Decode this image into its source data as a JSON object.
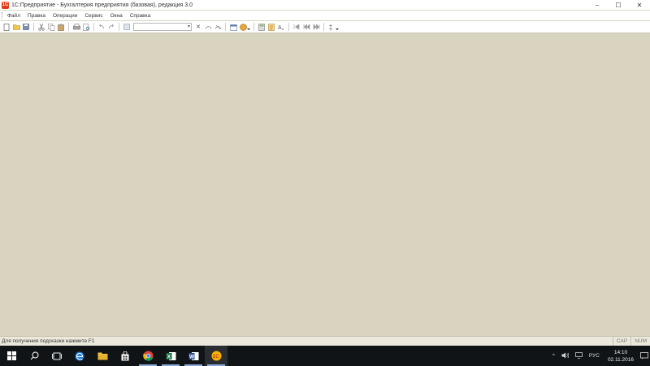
{
  "window": {
    "title": "1С:Предприятие - Бухгалтерия предприятия (базовая), редакция 3.0",
    "icon": "1c-logo-icon",
    "controls": {
      "minimize": "–",
      "maximize": "☐",
      "close": "✕"
    }
  },
  "menu": {
    "items": [
      {
        "label": "Файл"
      },
      {
        "label": "Правка"
      },
      {
        "label": "Операции"
      },
      {
        "label": "Сервис"
      },
      {
        "label": "Окна"
      },
      {
        "label": "Справка"
      }
    ]
  },
  "toolbar": {
    "search_value": "",
    "icons": [
      "new-document-icon",
      "open-folder-icon",
      "save-icon",
      "cut-icon",
      "copy-icon",
      "paste-icon",
      "print-icon",
      "print-preview-icon",
      "undo-icon",
      "redo-icon",
      "find-icon",
      "clear-icon",
      "find-next-icon",
      "find-prev-icon",
      "calendar-icon",
      "calculator-icon",
      "help-icon",
      "first-record-icon",
      "prev-record-icon",
      "next-record-icon",
      "font-size-icon"
    ]
  },
  "statusbar": {
    "hint": "Для получения подсказки нажмите F1",
    "cap": "CAP",
    "num": "NUM"
  },
  "taskbar": {
    "apps": [
      "windows-start-icon",
      "search-icon",
      "task-view-icon",
      "edge-icon",
      "file-explorer-icon",
      "store-icon",
      "chrome-icon",
      "excel-icon",
      "word-icon",
      "1c-app-icon"
    ],
    "active_app": "1c-app-icon",
    "tray": {
      "language": "РУС",
      "time": "14:10",
      "date": "02.11.2016"
    }
  },
  "colors": {
    "workspace": "#d9d4c0",
    "taskbar": "#111417",
    "accent": "#e23b1c"
  }
}
